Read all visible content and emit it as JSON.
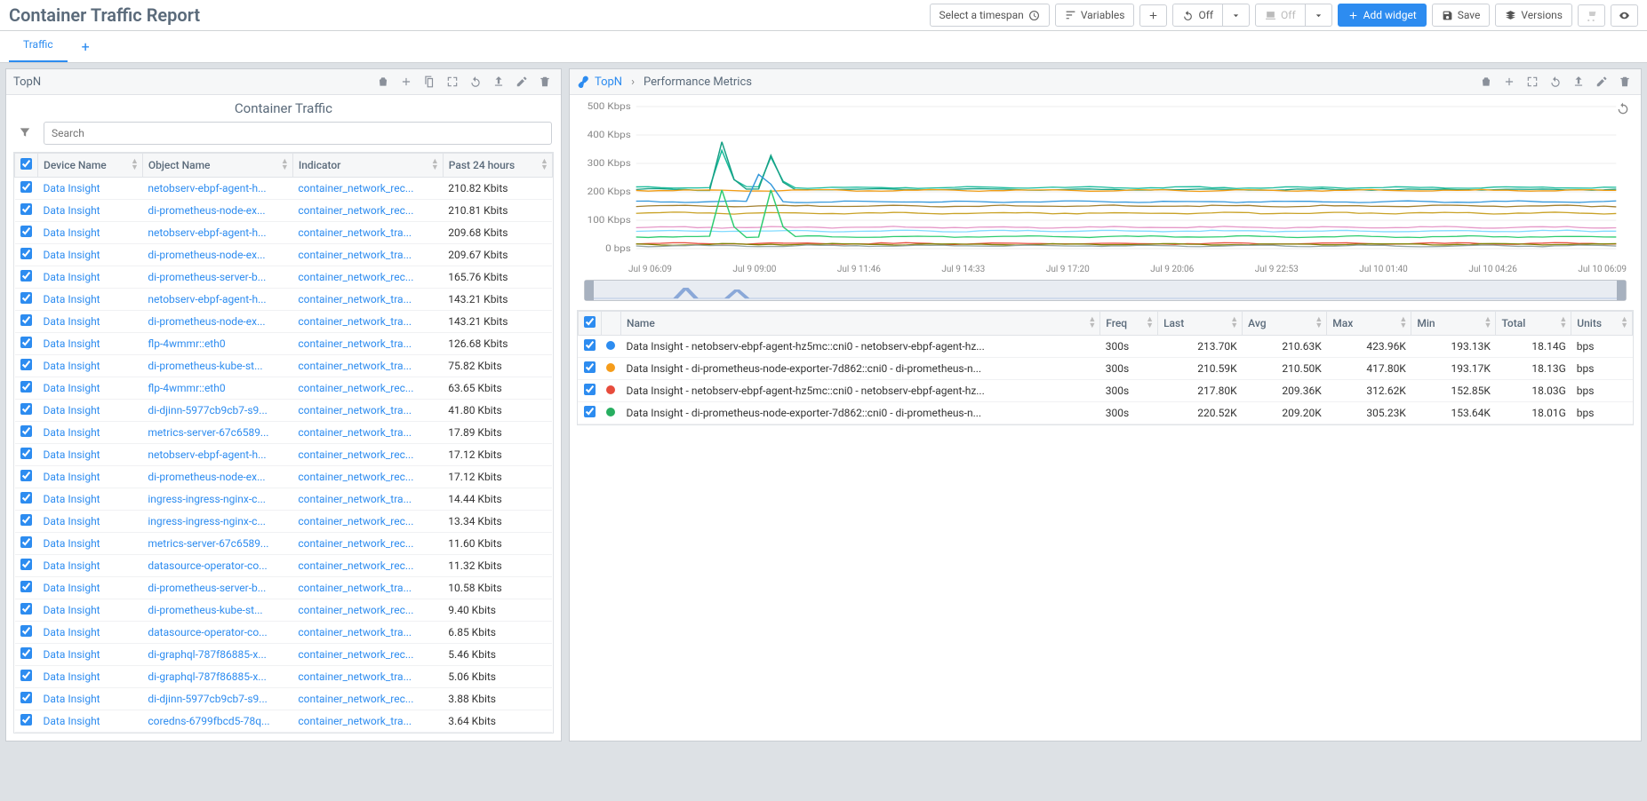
{
  "header": {
    "title": "Container Traffic Report",
    "timespan_label": "Select a timespan",
    "variables_label": "Variables",
    "off1_label": "Off",
    "off2_label": "Off",
    "add_widget_label": "Add widget",
    "save_label": "Save",
    "versions_label": "Versions"
  },
  "tabs": {
    "active": "Traffic"
  },
  "left_panel": {
    "breadcrumb": "TopN",
    "subtitle": "Container Traffic",
    "search_placeholder": "Search",
    "columns": {
      "device": "Device Name",
      "object": "Object Name",
      "indicator": "Indicator",
      "past24": "Past 24 hours"
    },
    "rows": [
      {
        "device": "Data Insight",
        "object": "netobserv-ebpf-agent-h...",
        "indicator": "container_network_rec...",
        "past24": "210.82 Kbits"
      },
      {
        "device": "Data Insight",
        "object": "di-prometheus-node-ex...",
        "indicator": "container_network_rec...",
        "past24": "210.81 Kbits"
      },
      {
        "device": "Data Insight",
        "object": "netobserv-ebpf-agent-h...",
        "indicator": "container_network_tra...",
        "past24": "209.68 Kbits"
      },
      {
        "device": "Data Insight",
        "object": "di-prometheus-node-ex...",
        "indicator": "container_network_tra...",
        "past24": "209.67 Kbits"
      },
      {
        "device": "Data Insight",
        "object": "di-prometheus-server-b...",
        "indicator": "container_network_rec...",
        "past24": "165.76 Kbits"
      },
      {
        "device": "Data Insight",
        "object": "netobserv-ebpf-agent-h...",
        "indicator": "container_network_tra...",
        "past24": "143.21 Kbits"
      },
      {
        "device": "Data Insight",
        "object": "di-prometheus-node-ex...",
        "indicator": "container_network_tra...",
        "past24": "143.21 Kbits"
      },
      {
        "device": "Data Insight",
        "object": "flp-4wmmr::eth0",
        "indicator": "container_network_tra...",
        "past24": "126.68 Kbits"
      },
      {
        "device": "Data Insight",
        "object": "di-prometheus-kube-st...",
        "indicator": "container_network_tra...",
        "past24": "75.82 Kbits"
      },
      {
        "device": "Data Insight",
        "object": "flp-4wmmr::eth0",
        "indicator": "container_network_rec...",
        "past24": "63.65 Kbits"
      },
      {
        "device": "Data Insight",
        "object": "di-djinn-5977cb9cb7-s9...",
        "indicator": "container_network_tra...",
        "past24": "41.80 Kbits"
      },
      {
        "device": "Data Insight",
        "object": "metrics-server-67c6589...",
        "indicator": "container_network_tra...",
        "past24": "17.89 Kbits"
      },
      {
        "device": "Data Insight",
        "object": "netobserv-ebpf-agent-h...",
        "indicator": "container_network_rec...",
        "past24": "17.12 Kbits"
      },
      {
        "device": "Data Insight",
        "object": "di-prometheus-node-ex...",
        "indicator": "container_network_rec...",
        "past24": "17.12 Kbits"
      },
      {
        "device": "Data Insight",
        "object": "ingress-ingress-nginx-c...",
        "indicator": "container_network_tra...",
        "past24": "14.44 Kbits"
      },
      {
        "device": "Data Insight",
        "object": "ingress-ingress-nginx-c...",
        "indicator": "container_network_rec...",
        "past24": "13.34 Kbits"
      },
      {
        "device": "Data Insight",
        "object": "metrics-server-67c6589...",
        "indicator": "container_network_rec...",
        "past24": "11.60 Kbits"
      },
      {
        "device": "Data Insight",
        "object": "datasource-operator-co...",
        "indicator": "container_network_rec...",
        "past24": "11.32 Kbits"
      },
      {
        "device": "Data Insight",
        "object": "di-prometheus-server-b...",
        "indicator": "container_network_tra...",
        "past24": "10.58 Kbits"
      },
      {
        "device": "Data Insight",
        "object": "di-prometheus-kube-st...",
        "indicator": "container_network_rec...",
        "past24": "9.40 Kbits"
      },
      {
        "device": "Data Insight",
        "object": "datasource-operator-co...",
        "indicator": "container_network_tra...",
        "past24": "6.85 Kbits"
      },
      {
        "device": "Data Insight",
        "object": "di-graphql-787f86885-x...",
        "indicator": "container_network_rec...",
        "past24": "5.46 Kbits"
      },
      {
        "device": "Data Insight",
        "object": "di-graphql-787f86885-x...",
        "indicator": "container_network_tra...",
        "past24": "5.06 Kbits"
      },
      {
        "device": "Data Insight",
        "object": "di-djinn-5977cb9cb7-s9...",
        "indicator": "container_network_rec...",
        "past24": "3.88 Kbits"
      },
      {
        "device": "Data Insight",
        "object": "coredns-6799fbcd5-78q...",
        "indicator": "container_network_tra...",
        "past24": "3.64 Kbits"
      }
    ]
  },
  "right_panel": {
    "breadcrumb1": "TopN",
    "breadcrumb2": "Performance Metrics",
    "y_labels": [
      "500 Kbps",
      "400 Kbps",
      "300 Kbps",
      "200 Kbps",
      "100 Kbps",
      "0 bps"
    ],
    "x_labels": [
      "Jul 9 06:09",
      "Jul 9 09:00",
      "Jul 9 11:46",
      "Jul 9 14:33",
      "Jul 9 17:20",
      "Jul 9 20:06",
      "Jul 9 22:53",
      "Jul 10 01:40",
      "Jul 10 04:26",
      "Jul 10 06:09"
    ],
    "table": {
      "columns": {
        "name": "Name",
        "freq": "Freq",
        "last": "Last",
        "avg": "Avg",
        "max": "Max",
        "min": "Min",
        "total": "Total",
        "units": "Units"
      },
      "rows": [
        {
          "color": "#2d8cf0",
          "name": "Data Insight - netobserv-ebpf-agent-hz5mc::cni0 - netobserv-ebpf-agent-hz...",
          "freq": "300s",
          "last": "213.70K",
          "avg": "210.63K",
          "max": "423.96K",
          "min": "193.13K",
          "total": "18.14G",
          "units": "bps"
        },
        {
          "color": "#f59c1a",
          "name": "Data Insight - di-prometheus-node-exporter-7d862::cni0 - di-prometheus-n...",
          "freq": "300s",
          "last": "210.59K",
          "avg": "210.50K",
          "max": "417.80K",
          "min": "193.17K",
          "total": "18.13G",
          "units": "bps"
        },
        {
          "color": "#e74c3c",
          "name": "Data Insight - netobserv-ebpf-agent-hz5mc::cni0 - netobserv-ebpf-agent-hz...",
          "freq": "300s",
          "last": "217.80K",
          "avg": "209.36K",
          "max": "312.62K",
          "min": "152.85K",
          "total": "18.03G",
          "units": "bps"
        },
        {
          "color": "#27ae60",
          "name": "Data Insight - di-prometheus-node-exporter-7d862::cni0 - di-prometheus-n...",
          "freq": "300s",
          "last": "220.52K",
          "avg": "209.20K",
          "max": "305.23K",
          "min": "153.64K",
          "total": "18.01G",
          "units": "bps"
        }
      ]
    }
  },
  "chart_data": {
    "type": "line",
    "xlabel": "",
    "ylabel": "",
    "ylim": [
      0,
      500
    ],
    "y_unit": "Kbps",
    "x_ticks": [
      "Jul 9 06:09",
      "Jul 9 09:00",
      "Jul 9 11:46",
      "Jul 9 14:33",
      "Jul 9 17:20",
      "Jul 9 20:06",
      "Jul 9 22:53",
      "Jul 10 01:40",
      "Jul 10 04:26",
      "Jul 10 06:09"
    ],
    "series": [
      {
        "name": "teal-a",
        "color": "#1abc9c",
        "baseline": 215,
        "spikes": [
          {
            "x": 0.09,
            "y": 380
          },
          {
            "x": 0.14,
            "y": 350
          }
        ]
      },
      {
        "name": "teal-b",
        "color": "#16a085",
        "baseline": 208,
        "spikes": [
          {
            "x": 0.09,
            "y": 420
          },
          {
            "x": 0.14,
            "y": 360
          }
        ]
      },
      {
        "name": "orange",
        "color": "#f39c12",
        "baseline": 205,
        "spikes": []
      },
      {
        "name": "blue",
        "color": "#3498db",
        "baseline": 165,
        "spikes": [
          {
            "x": 0.13,
            "y": 330
          }
        ]
      },
      {
        "name": "olive",
        "color": "#a27f2e",
        "baseline": 150,
        "spikes": []
      },
      {
        "name": "gold",
        "color": "#c9a227",
        "baseline": 125,
        "spikes": []
      },
      {
        "name": "pink",
        "color": "#e598c8",
        "baseline": 75,
        "spikes": []
      },
      {
        "name": "cyan",
        "color": "#7fdbff",
        "baseline": 62,
        "spikes": []
      },
      {
        "name": "green-low",
        "color": "#2ecc71",
        "baseline": 42,
        "spikes": [
          {
            "x": 0.09,
            "y": 250
          },
          {
            "x": 0.14,
            "y": 250
          }
        ]
      },
      {
        "name": "red-low",
        "color": "#e74c3c",
        "baseline": 18,
        "spikes": []
      },
      {
        "name": "olive-low",
        "color": "#808000",
        "baseline": 15,
        "spikes": []
      },
      {
        "name": "gray-low",
        "color": "#95a5a6",
        "baseline": 10,
        "spikes": []
      }
    ]
  }
}
